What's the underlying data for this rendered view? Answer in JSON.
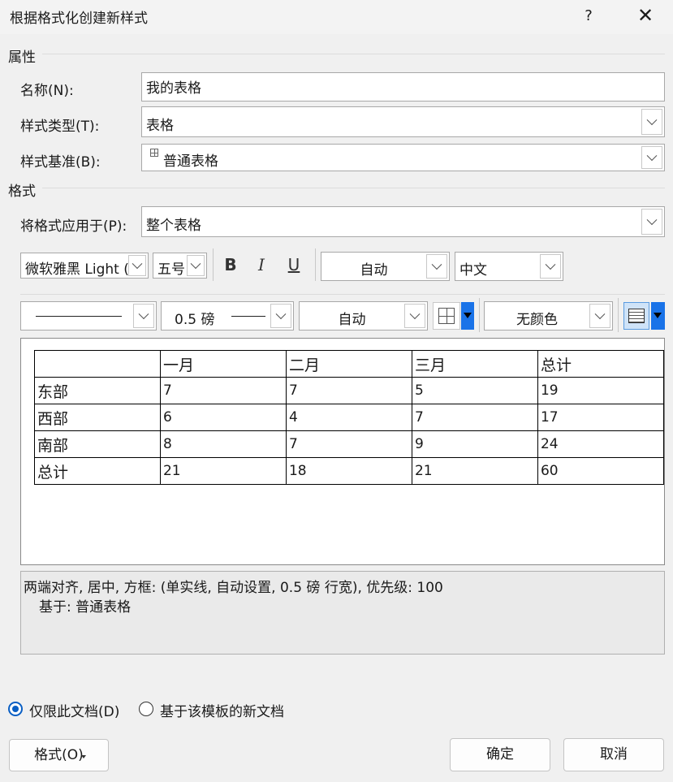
{
  "window": {
    "title": "根据格式化创建新样式",
    "help": "?",
    "close": "✕"
  },
  "properties": {
    "section": "属性",
    "name_label": "名称(N):",
    "name_value": "我的表格",
    "type_label": "样式类型(T):",
    "type_value": "表格",
    "based_label": "样式基准(B):",
    "based_value": "普通表格",
    "based_icon": "table-icon"
  },
  "format": {
    "section": "格式",
    "apply_label": "将格式应用于(P):",
    "apply_value": "整个表格",
    "font": "微软雅黑 Light (",
    "size": "五号",
    "bold": "B",
    "italic": "I",
    "underline": "U",
    "font_color": "自动",
    "script": "中文",
    "border_style": "",
    "border_width": "0.5 磅",
    "border_color": "自动",
    "shading": "无颜色"
  },
  "preview": {
    "rows": [
      [
        "",
        "一月",
        "二月",
        "三月",
        "总计"
      ],
      [
        "东部",
        "7",
        "7",
        "5",
        "19"
      ],
      [
        "西部",
        "6",
        "4",
        "7",
        "17"
      ],
      [
        "南部",
        "8",
        "7",
        "9",
        "24"
      ],
      [
        "总计",
        "21",
        "18",
        "21",
        "60"
      ]
    ]
  },
  "description": {
    "line1": "两端对齐, 居中, 方框: (单实线, 自动设置,  0.5 磅 行宽), 优先级: 100",
    "line2": "基于: 普通表格"
  },
  "options": {
    "only_doc": "仅限此文档(D)",
    "new_docs": "基于该模板的新文档",
    "selected": "only_doc"
  },
  "buttons": {
    "format": "格式(O)",
    "ok": "确定",
    "cancel": "取消"
  },
  "colors": {
    "accent": "#0a5fc4",
    "dropdown_blue": "#1a73e8"
  }
}
